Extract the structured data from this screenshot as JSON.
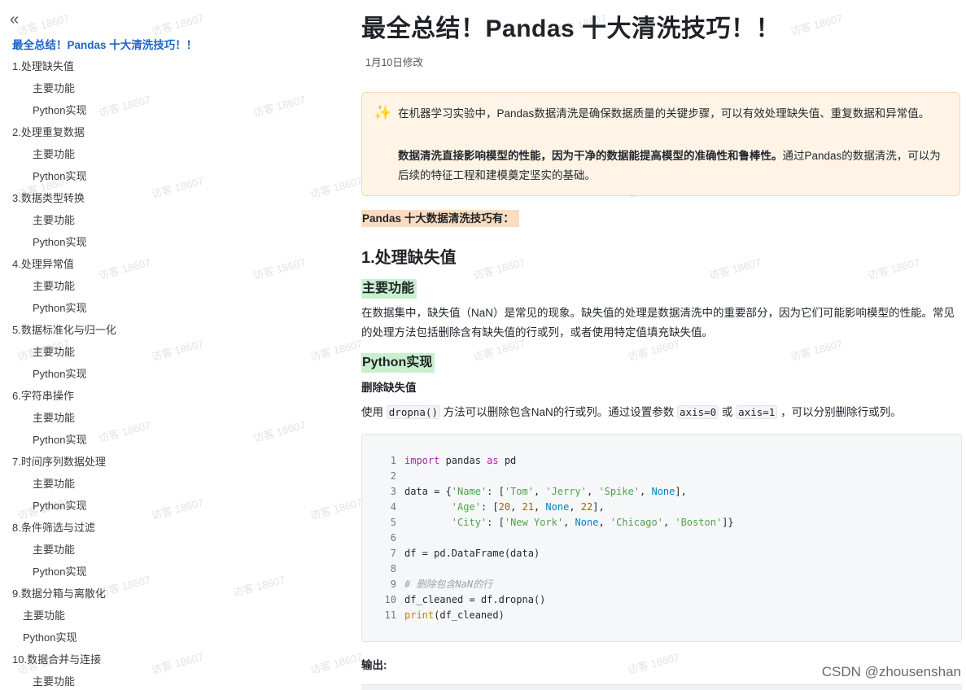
{
  "sidebar": {
    "collapse_icon": "«",
    "toc_title": "最全总结！Pandas 十大清洗技巧！！",
    "items": [
      {
        "label": "1.处理缺失值",
        "level": 1
      },
      {
        "label": "主要功能",
        "level": 2
      },
      {
        "label": "Python实现",
        "level": 2
      },
      {
        "label": "2.处理重复数据",
        "level": 1
      },
      {
        "label": "主要功能",
        "level": 2
      },
      {
        "label": "Python实现",
        "level": 2
      },
      {
        "label": "3.数据类型转换",
        "level": 1
      },
      {
        "label": "主要功能",
        "level": 2
      },
      {
        "label": "Python实现",
        "level": 2
      },
      {
        "label": "4.处理异常值",
        "level": 1
      },
      {
        "label": "主要功能",
        "level": 2
      },
      {
        "label": "Python实现",
        "level": 2
      },
      {
        "label": "5.数据标准化与归一化",
        "level": 1
      },
      {
        "label": "主要功能",
        "level": 2
      },
      {
        "label": "Python实现",
        "level": 2
      },
      {
        "label": "6.字符串操作",
        "level": 1
      },
      {
        "label": "主要功能",
        "level": 2
      },
      {
        "label": "Python实现",
        "level": 2
      },
      {
        "label": "7.时间序列数据处理",
        "level": 1
      },
      {
        "label": "主要功能",
        "level": 2
      },
      {
        "label": "Python实现",
        "level": 2
      },
      {
        "label": "8.条件筛选与过滤",
        "level": 1
      },
      {
        "label": "主要功能",
        "level": 2
      },
      {
        "label": "Python实现",
        "level": 2
      },
      {
        "label": "9.数据分箱与离散化",
        "level": 1
      },
      {
        "label": "主要功能",
        "level": 3
      },
      {
        "label": "Python实现",
        "level": 3
      },
      {
        "label": "10.数据合并与连接",
        "level": 1
      },
      {
        "label": "主要功能",
        "level": 2
      }
    ]
  },
  "article": {
    "title": "最全总结！Pandas 十大清洗技巧！！",
    "modified": "1月10日修改",
    "callout": {
      "icon": "sparkles-icon",
      "p1": "在机器学习实验中，Pandas数据清洗是确保数据质量的关键步骤，可以有效处理缺失值、重复数据和异常值。",
      "p2_bold": "数据清洗直接影响模型的性能，因为干净的数据能提高模型的准确性和鲁棒性。",
      "p2_rest": "通过Pandas的数据清洗，可以为后续的特征工程和建模奠定坚实的基础。"
    },
    "highlight_label": "Pandas 十大数据清洗技巧有：",
    "section1_heading": "1.处理缺失值",
    "main_func_heading": "主要功能",
    "main_func_text": "在数据集中，缺失值（NaN）是常见的现象。缺失值的处理是数据清洗中的重要部分，因为它们可能影响模型的性能。常见的处理方法包括删除含有缺失值的行或列，或者使用特定值填充缺失值。",
    "python_heading": "Python实现",
    "drop_heading": "删除缺失值",
    "usage_before": "使用 ",
    "usage_code1": "dropna()",
    "usage_mid1": " 方法可以删除包含NaN的行或列。通过设置参数 ",
    "usage_code2": "axis=0",
    "usage_mid2": " 或 ",
    "usage_code3": "axis=1",
    "usage_after": " ，可以分别删除行或列。",
    "output_label": "输出:"
  },
  "code": {
    "line_numbers": [
      "1",
      "2",
      "3",
      "4",
      "5",
      "6",
      "7",
      "8",
      "9",
      "10",
      "11"
    ]
  },
  "footer": {
    "watermark_brand": "CSDN @zhousenshan",
    "bg_watermark": "访客 18607"
  }
}
